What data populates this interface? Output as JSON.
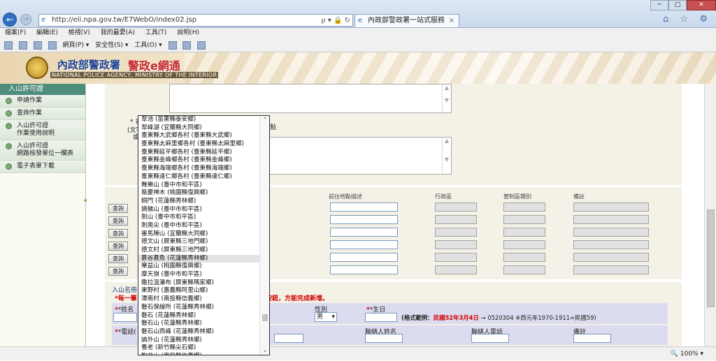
{
  "browser": {
    "url": "http://eli.npa.gov.tw/E7WebO/index02.jsp",
    "tab_title": "內政部警政署一站式服務",
    "tab_close": "×",
    "addr_tools": "ρ ▾ 🔒 ↻",
    "window_buttons": [
      "─",
      "□",
      "✕"
    ],
    "right_icons": "⌂ ☆ ⚙",
    "menu": [
      "檔案(F)",
      "編輯(E)",
      "檢視(V)",
      "我的最愛(A)",
      "工具(T)",
      "說明(H)"
    ],
    "toolbar": [
      "網頁(P) ▾",
      "安全性(S) ▾",
      "工具(O) ▾"
    ],
    "zoom": "🔍 100%  ▾"
  },
  "banner": {
    "title": "內政部警政署",
    "subtitle": "警政e網通",
    "english": "NATIONAL POLICE AGENCY, MINISTRY OF THE INTERIOR"
  },
  "sidebar": {
    "header": "入山許可證",
    "items": [
      {
        "label": "申請作業"
      },
      {
        "label": "查詢作業"
      },
      {
        "label": "入山許可證\n作業使用說明"
      },
      {
        "label": "入山許可證\n網路核發單位一欄表"
      },
      {
        "label": "電子表單下載"
      }
    ]
  },
  "form": {
    "fragment_a": "* 名",
    "fragment_b": "(文字",
    "fragment_c": "或",
    "fragment_d": "點",
    "columns": [
      "前往地點描述",
      "行政區",
      "管制區類別",
      "備註"
    ],
    "query_label": "查詢",
    "members_title": "入山名冊",
    "warning": "*每一筆",
    "warning_tail": "按鈕，方能完成新增。",
    "name_label": "*姓名",
    "gender_label": "性別",
    "gender_value": "男",
    "birth_label": "*生日",
    "birth_hint_prefix": "(格式範例：",
    "birth_hint_red": "民國52年3月4日",
    "birth_hint_suffix": " → 0520304 ※西元年1970-1911=民國59)",
    "phone_label": "*電話(",
    "contact_name_label": "聯絡人姓名",
    "contact_phone_label": "聯絡人電話",
    "remark_label": "備註"
  },
  "dropdown": {
    "items": [
      "翠池 (苗栗縣泰安鄉)",
      "翠峰湖 (宜蘭縣大同鄉)",
      "臺東縣大武鄉各村 (臺東縣大武鄉)",
      "臺東縣太麻里鄉各村 (臺東縣太麻里鄉)",
      "臺東縣延平鄉各村 (臺東縣延平鄉)",
      "臺東縣金峰鄉各村 (臺東縣金峰鄉)",
      "臺東縣海端鄉各村 (臺東縣海端鄉)",
      "臺東縣達仁鄉各村 (臺東縣達仁鄉)",
      "舞樂山 (臺中市和平區)",
      "蔡慶神木 (桃園縣復興鄉)",
      "銅門 (花蓮縣秀林鄉)",
      "摘豬山 (臺中市和平區)",
      "劍山 (臺中市和平區)",
      "劍南尖 (臺中市和平區)",
      "審馬陣山 (宜蘭縣大同鄉)",
      "德文山 (屏東縣三地門鄉)",
      "德文村 (屏東縣三地門鄉)",
      "慕谷慕魚 (花蓮縣秀林鄉)",
      "樂益山 (桃園縣復興鄉)",
      "摩天嶺 (臺中市和平區)",
      "撒拉溫瀑布 (屏東縣瑪家鄉)",
      "東野村 (嘉義縣阿里山鄉)",
      "潭南村 (南投縣信義鄉)",
      "磐石保線所 (花蓮縣秀林鄉)",
      "磐石 (花蓮縣秀林鄉)",
      "磐石山 (花蓮縣秀林鄉)",
      "磐石山西峰 (花蓮縣秀林鄉)",
      "論外山 (花蓮縣秀林鄉)",
      "養老 (新竹縣尖石鄉)",
      "駒盆山 (南投縣信義鄉)"
    ],
    "selected_index": 17,
    "scroll_up": "⌃",
    "scroll_down": "⌄"
  }
}
